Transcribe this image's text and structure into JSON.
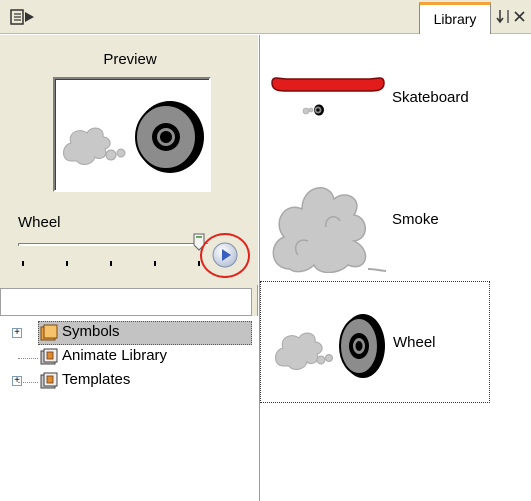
{
  "tabs": {
    "library": "Library"
  },
  "icons": {
    "panel_menu": "panel-menu-icon",
    "dock": "dock-arrow-icon",
    "close": "close-icon",
    "play": "play-icon",
    "folder": "folder-icon",
    "library_folder": "library-folder-icon",
    "expand": "expand-plus-icon"
  },
  "preview": {
    "title": "Preview",
    "symbol_name": "Wheel"
  },
  "tree": {
    "items": [
      {
        "label": "Symbols",
        "expander": "+",
        "selected": true
      },
      {
        "label": "Animate Library",
        "expander": "",
        "selected": false
      },
      {
        "label": "Templates",
        "expander": "+",
        "selected": false
      }
    ]
  },
  "library": {
    "items": [
      {
        "label": "Skateboard"
      },
      {
        "label": "Smoke"
      },
      {
        "label": "Wheel",
        "selected": true
      }
    ]
  },
  "colors": {
    "highlight_ring": "#e0241c",
    "tab_accent": "#f2a33a",
    "skateboard_red": "#e21b1b",
    "smoke_gray": "#c8c8c8"
  }
}
